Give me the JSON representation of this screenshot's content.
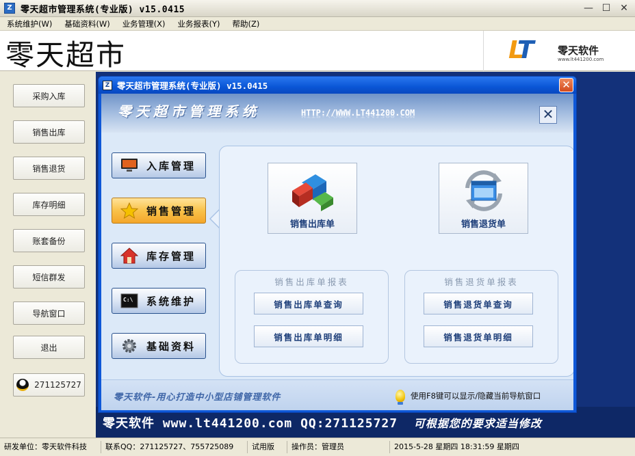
{
  "window": {
    "title": "零天超市管理系统(专业版)  v15.0415",
    "controls": {
      "minimize": "—",
      "maximize": "☐",
      "close": "✕"
    }
  },
  "menu": [
    {
      "label": "系统维护(W)"
    },
    {
      "label": "基础资料(W)"
    },
    {
      "label": "业务管理(X)"
    },
    {
      "label": "业务报表(Y)"
    },
    {
      "label": "帮助(Z)"
    }
  ],
  "header": {
    "brand": "零天超市",
    "logo": {
      "mark_l": "L",
      "mark_t": "T",
      "name": "零天软件",
      "url": "www.lt441200.com"
    }
  },
  "sidebar": {
    "items": [
      {
        "label": "采购入库"
      },
      {
        "label": "销售出库"
      },
      {
        "label": "销售退货"
      },
      {
        "label": "库存明细"
      },
      {
        "label": "账套备份"
      },
      {
        "label": "短信群发"
      },
      {
        "label": "导航窗口"
      },
      {
        "label": "退出"
      }
    ],
    "qq": {
      "label": "271125727"
    }
  },
  "desktop": {
    "slogan": "零天软件 www.lt441200.com QQ:271125727",
    "note": "可根据您的要求适当修改"
  },
  "dialog": {
    "title": "零天超市管理系统(专业版)  v15.0415",
    "close": "✕",
    "banner": {
      "title": "零天超市管理系统",
      "url": "HTTP://WWW.LT441200.COM",
      "close": "✕"
    },
    "nav": [
      {
        "label": "入库管理",
        "icon": "monitor-icon",
        "active": false
      },
      {
        "label": "销售管理",
        "icon": "star-icon",
        "active": true
      },
      {
        "label": "库存管理",
        "icon": "house-icon",
        "active": false
      },
      {
        "label": "系统维护",
        "icon": "terminal-icon",
        "active": false
      },
      {
        "label": "基础资料",
        "icon": "gear-icon",
        "active": false
      }
    ],
    "tiles": [
      {
        "label": "销售出库单",
        "icon": "puzzle-icon"
      },
      {
        "label": "销售退货单",
        "icon": "refresh-window-icon"
      }
    ],
    "groups": [
      {
        "title": "销售出库单报表",
        "buttons": [
          "销售出库单查询",
          "销售出库单明细"
        ]
      },
      {
        "title": "销售退货单报表",
        "buttons": [
          "销售退货单查询",
          "销售退货单明细"
        ]
      }
    ],
    "footer": {
      "slogan": "零天软件-用心打造中小型店铺管理软件",
      "tip": "使用F8键可以显示/隐藏当前导航窗口"
    }
  },
  "statusbar": [
    {
      "text": "研发单位：零天软件科技"
    },
    {
      "text": "联系QQ：271125727、755725089"
    },
    {
      "text": "试用版"
    },
    {
      "text": "操作员：管理员"
    },
    {
      "text": "2015-5-28 星期四 18:31:59 星期四"
    }
  ],
  "colors": {
    "desktop": "#13317A",
    "dialog_frame": "#0F58D8",
    "active_nav": "#F9C24A",
    "tile_text": "#1E3F7A"
  }
}
